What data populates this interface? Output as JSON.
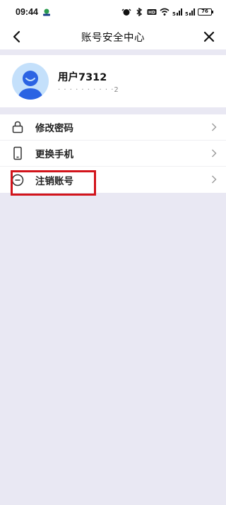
{
  "status_bar": {
    "time": "09:44",
    "battery": "76"
  },
  "nav": {
    "title": "账号安全中心"
  },
  "profile": {
    "username": "用户7312",
    "phone_masked": "· · · · · · · · · ·2"
  },
  "menu": {
    "items": [
      {
        "label": "修改密码",
        "icon": "lock-icon"
      },
      {
        "label": "更换手机",
        "icon": "phone-icon"
      },
      {
        "label": "注销账号",
        "icon": "minus-circle-icon"
      }
    ]
  },
  "colors": {
    "annotation": "#d2141b",
    "page_bg": "#e9e8f3",
    "avatar_bg": "#c4e0fb",
    "avatar_fg": "#2b63e3"
  }
}
